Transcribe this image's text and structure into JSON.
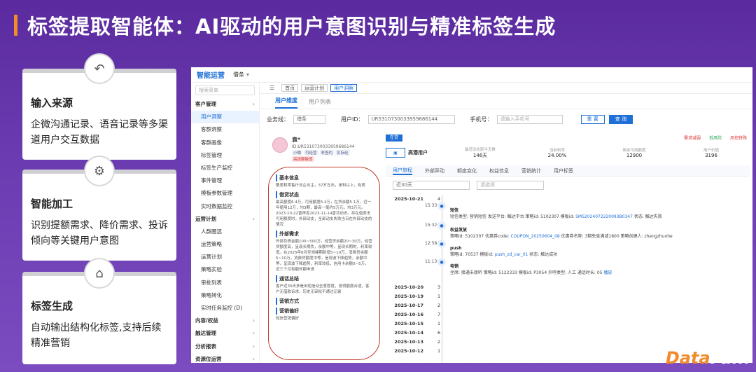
{
  "slide": {
    "title": "标签提取智能体：AI驱动的用户意图识别与精准标签生成",
    "watermark_a": "Data",
    "watermark_b": "Fun."
  },
  "cards": [
    {
      "title": "输入来源",
      "desc": "企微沟通记录、语音记录等多渠道用户交互数据",
      "icon": "undo-arrow-icon"
    },
    {
      "title": "智能加工",
      "desc": "识别提额需求、降价需求、投诉倾向等关键用户意图",
      "icon": "gear-icon"
    },
    {
      "title": "标签生成",
      "desc": "自动输出结构化标签,支持后续精准营销",
      "icon": "tag-icon"
    }
  ],
  "app": {
    "logo": "智能运营",
    "product": "借条",
    "search_placeholder": "搜索菜单",
    "sidebar": [
      {
        "label": "客户管理",
        "group": true
      },
      {
        "label": "用户洞察",
        "active": true
      },
      {
        "label": "客群洞察"
      },
      {
        "label": "客群画像"
      },
      {
        "label": "标签管理"
      },
      {
        "label": "标签生产监控"
      },
      {
        "label": "事件管理"
      },
      {
        "label": "模板参数管理"
      },
      {
        "label": "实时数据监控"
      },
      {
        "label": "运营计划",
        "group": true
      },
      {
        "label": "人群圈选"
      },
      {
        "label": "运营策略"
      },
      {
        "label": "运营计划"
      },
      {
        "label": "策略实验"
      },
      {
        "label": "审批列表"
      },
      {
        "label": "策略转化"
      },
      {
        "label": "实时任务监控 (D)"
      },
      {
        "label": "内容/权益",
        "group": true
      },
      {
        "label": "触达管理",
        "group": true
      },
      {
        "label": "分析报表",
        "group": true
      },
      {
        "label": "资源位运营",
        "group": true
      }
    ],
    "tabs": [
      "首页",
      "运营计划",
      "用户洞察"
    ],
    "subtabs": [
      "用户维度",
      "用户列表"
    ],
    "filters": {
      "biz_label": "业务线：",
      "biz_value": "借条",
      "uid_label": "用户ID：",
      "uid_value": "UR5310730033959686144",
      "phone_label": "手机号：",
      "phone_placeholder": "请输入手机号",
      "reset": "重 置",
      "query": "查 询"
    },
    "profile": {
      "name": "袁*",
      "id": "ID:UR5310730033959686144",
      "chips": [
        "小微",
        "可经营",
        "非签约",
        "实际经"
      ],
      "red_chip": "高提额敏感",
      "sections": [
        {
          "title": "基本信息",
          "desc": "敬爱和零售行业企业主，37岁左右，单科以上，有房"
        },
        {
          "title": "借贷状态",
          "desc": "最高额度6.4万，可用额度6.4万，在贷余额5.1万，近一年使用12万，均3期，最高一笔约5万元，均3万元。2023-10-22曾停息2023-11-14曾功动去。存在借务无可用额度时，外部动支，全部动支失败当日在外部动支的情况"
        },
        {
          "title": "外部需求",
          "desc": "外部负债金额100~500万，经营贷余额20~30万，经营贷额度高，呈现长期负，余额中等，呈现长期的，利率较低。在2025年8月至领峰期新增5~10万，消费贷余额5~10万，消费贷额度中等，呈现波下降趋势，余额中等，呈现波下降趋势，利率较低，信用卡余额0~5万，近三个月有额外额申请"
        },
        {
          "title": "通话总结",
          "desc": "客户近30天多是出短信动全意愿度，觉得额度合适，客户无借款诉求，历史无审批不通过记录"
        },
        {
          "title": "营销方式",
          "desc": ""
        },
        {
          "title": "营销偏好",
          "desc": "短信营销偏好"
        }
      ]
    },
    "right": {
      "badge": "在贷",
      "type_label": "高潜用户",
      "alerts": [
        "需求减弱",
        "低风险",
        "风控特殊"
      ],
      "stats": [
        {
          "label": "最近动支距今天数",
          "value": "146天"
        },
        {
          "label": "当前利率",
          "value": "24.00%"
        },
        {
          "label": "剩余可用额度",
          "value": "12900"
        },
        {
          "label": "用户价值",
          "value": "3196"
        }
      ],
      "tabs": [
        "用户旅程",
        "外部异动",
        "额度变化",
        "权益信息",
        "营销统计",
        "用户标签"
      ],
      "range": "近30天",
      "range_placeholder": "请选择",
      "timeline_top": {
        "date": "2025-10-21",
        "count": "4"
      },
      "events": [
        {
          "time": "15:33:31",
          "icon": "sms-icon",
          "title": "短信",
          "desc": "短信类型: 营销短信    发送平台: 触达平台    策略id: 5102307    模板id: ",
          "link": "SMS2024072220093B0347",
          "desc2": "    状态: 触达失败"
        },
        {
          "time": "15:32:45",
          "icon": "coupon-icon",
          "title": "权益发放",
          "desc": "策略id: 5102307    优惠券code: ",
          "link": "COUPON_20250604_08",
          "desc2": "    优惠券名称: 3期免息满减1800    策略创建人: zhengzhuohe"
        },
        {
          "time": "12:58:19",
          "icon": "push-icon",
          "title": "push",
          "desc": "策略id: 70537    模板id: ",
          "link": "push_zd_car_01",
          "desc2": "    状态: 触达成功"
        },
        {
          "time": "11:13:17",
          "icon": "phone-icon",
          "title": "电销",
          "desc": "坐席: 接通未接听    策略id: 5122333    模板id: P3054    外呼类型: 人工    通话时长: 05  ",
          "link": "播放",
          "desc2": ""
        }
      ],
      "dates": [
        {
          "date": "2025-10-20",
          "count": "3"
        },
        {
          "date": "2025-10-19",
          "count": "1"
        },
        {
          "date": "2025-10-17",
          "count": "2"
        },
        {
          "date": "2025-10-16",
          "count": "7"
        },
        {
          "date": "2025-10-15",
          "count": "1"
        },
        {
          "date": "2025-10-14",
          "count": "6"
        },
        {
          "date": "2025-10-13",
          "count": "2"
        },
        {
          "date": "2025-10-12",
          "count": "1"
        }
      ]
    }
  },
  "colors": {
    "accent": "#f28b2b",
    "brand": "#1f6fd6",
    "bg": "#6a3bb0"
  }
}
